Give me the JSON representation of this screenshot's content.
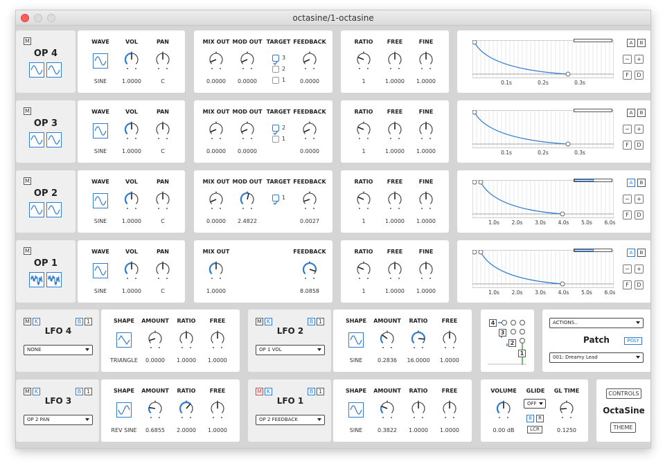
{
  "window": {
    "title": "octasine/1-octasine"
  },
  "colors": {
    "accent": "#2e7bd1",
    "panel": "#ffffff",
    "background": "#d5d5d5",
    "mute_active": "#dd3333"
  },
  "headers": {
    "wave": "WAVE",
    "vol": "VOL",
    "pan": "PAN",
    "mix_out": "MIX OUT",
    "mod_out": "MOD OUT",
    "target": "TARGET",
    "feedback": "FEEDBACK",
    "ratio": "RATIO",
    "free": "FREE",
    "fine": "FINE",
    "shape": "SHAPE",
    "amount": "AMOUNT"
  },
  "mute_label": "M",
  "operators": [
    {
      "name": "OP 4",
      "wave": "SINE",
      "vol": "1.0000",
      "pan": "C",
      "mix_out": "0.0000",
      "mod_out": "0.0000",
      "targets": [
        {
          "label": "3",
          "checked": true
        },
        {
          "label": "2",
          "checked": false
        },
        {
          "label": "1",
          "checked": false
        }
      ],
      "feedback": "0.0000",
      "ratio": "1",
      "free": "1.0000",
      "fine": "1.0000",
      "env_ticks": [
        "0.1s",
        "0.2s",
        "0.3s"
      ],
      "env_buttons": [
        "A",
        "B",
        "−",
        "+",
        "F",
        "D"
      ]
    },
    {
      "name": "OP 3",
      "wave": "SINE",
      "vol": "1.0000",
      "pan": "C",
      "mix_out": "0.0000",
      "mod_out": "0.0000",
      "targets": [
        {
          "label": "2",
          "checked": true
        },
        {
          "label": "1",
          "checked": false
        }
      ],
      "feedback": "0.0000",
      "ratio": "1",
      "free": "1.0000",
      "fine": "1.0000",
      "env_ticks": [
        "0.1s",
        "0.2s",
        "0.3s"
      ],
      "env_buttons": [
        "A",
        "B",
        "−",
        "+",
        "F",
        "D"
      ]
    },
    {
      "name": "OP 2",
      "wave": "SINE",
      "vol": "1.0000",
      "pan": "C",
      "mix_out": "0.0000",
      "mod_out": "2.4822",
      "targets": [
        {
          "label": "1",
          "checked": true
        }
      ],
      "feedback": "0.0027",
      "ratio": "1",
      "free": "1.0000",
      "fine": "1.0000",
      "env_ticks": [
        "1.0s",
        "2.0s",
        "3.0s",
        "4.0s",
        "5.0s",
        "6.0s"
      ],
      "env_buttons": [
        "A",
        "B",
        "−",
        "+",
        "F",
        "D"
      ]
    },
    {
      "name": "OP 1",
      "wave": "SINE",
      "vol": "1.0000",
      "pan": "C",
      "mix_out": "1.0000",
      "feedback": "8.0858",
      "ratio": "1",
      "free": "1.0000",
      "fine": "1.0000",
      "env_ticks": [
        "1.0s",
        "2.0s",
        "3.0s",
        "4.0s",
        "5.0s",
        "6.0s"
      ],
      "env_buttons": [
        "A",
        "B",
        "−",
        "+",
        "F",
        "D"
      ]
    }
  ],
  "lfos": [
    {
      "name": "LFO 4",
      "target": "NONE",
      "shape": "TRIANGLE",
      "amount": "0.0000",
      "ratio": "1.0000",
      "free": "1.0000",
      "mute_active": false
    },
    {
      "name": "LFO 2",
      "target": "OP 1 VOL",
      "shape": "SINE",
      "amount": "0.2836",
      "ratio": "16.0000",
      "free": "1.0000",
      "mute_active": false
    },
    {
      "name": "LFO 3",
      "target": "OP 2 PAN",
      "shape": "REV SINE",
      "amount": "0.6855",
      "ratio": "2.0000",
      "free": "1.0000",
      "mute_active": false
    },
    {
      "name": "LFO 1",
      "target": "OP 2 FEEDBACK",
      "shape": "SINE",
      "amount": "0.3822",
      "ratio": "1.0000",
      "free": "1.0000",
      "mute_active": true
    }
  ],
  "lfo_buttons": {
    "m": "M",
    "k": "K",
    "b": "B",
    "one": "1"
  },
  "mod_matrix": {
    "boxes": [
      "4",
      "3",
      "2",
      "1"
    ]
  },
  "patch": {
    "actions": "ACTIONS..",
    "title": "Patch",
    "poly": "POLY",
    "preset": "001: Dreamy Lead"
  },
  "master": {
    "volume_label": "VOLUME",
    "volume": "0.00 dB",
    "glide_label": "GLIDE",
    "glide": "OFF",
    "glide_b": "B",
    "glide_r": "R",
    "glide_lcr": "LCR",
    "gl_time_label": "GL TIME",
    "gl_time": "0.1250"
  },
  "brand": {
    "controls": "CONTROLS",
    "name": "OctaSine",
    "theme": "THEME"
  }
}
